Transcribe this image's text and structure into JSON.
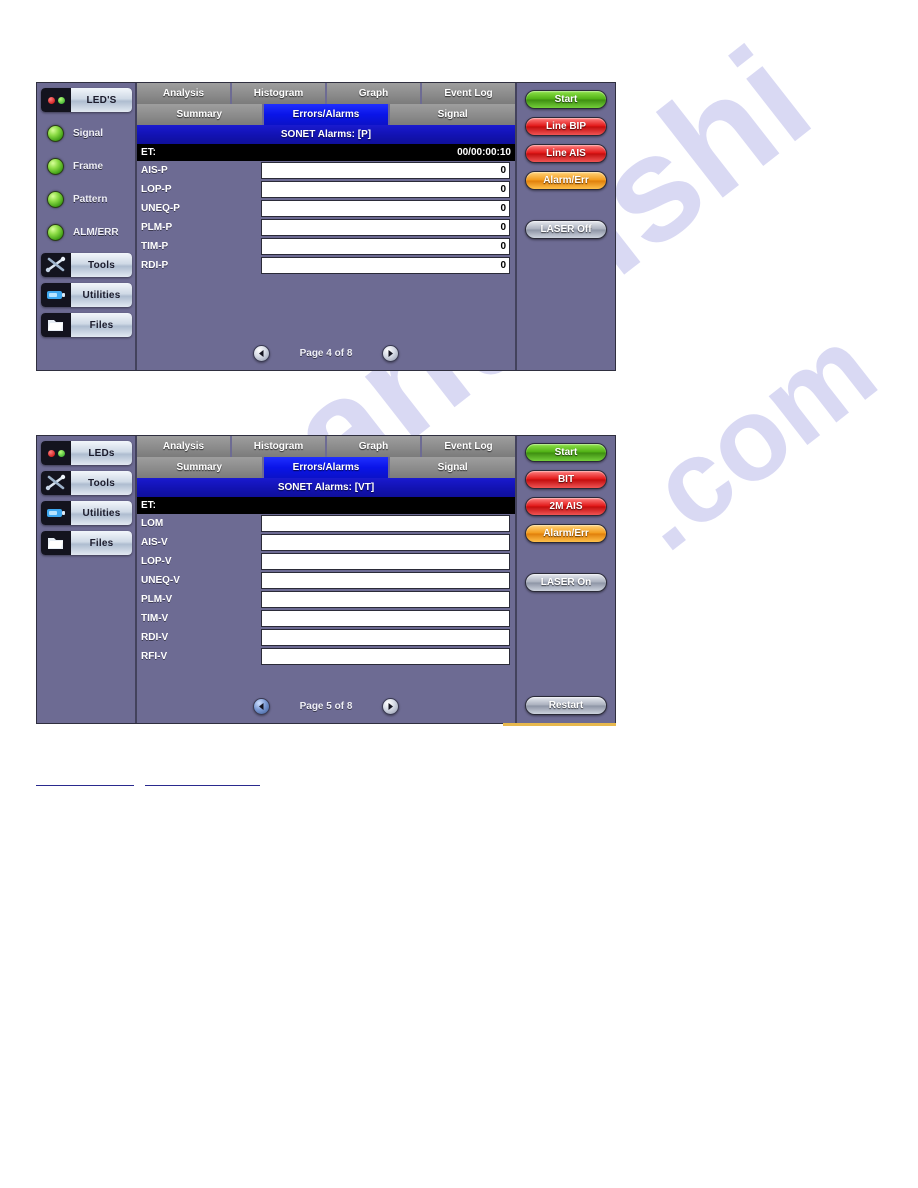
{
  "watermark": {
    "line1": "manualshi",
    "line2": ".com"
  },
  "panels": [
    {
      "id": "panel-1",
      "sidebar": {
        "main_button": {
          "label": "LED'S",
          "icon": "leds-icon"
        },
        "leds": [
          {
            "label": "Signal",
            "color": "#6dc42a"
          },
          {
            "label": "Frame",
            "color": "#6dc42a"
          },
          {
            "label": "Pattern",
            "color": "#6dc42a"
          },
          {
            "label": "ALM/ERR",
            "color": "#6dc42a"
          }
        ],
        "buttons": [
          {
            "label": "Tools",
            "icon": "tools-icon"
          },
          {
            "label": "Utilities",
            "icon": "utilities-icon"
          },
          {
            "label": "Files",
            "icon": "files-icon"
          }
        ]
      },
      "tabs_row1": [
        {
          "label": "Analysis",
          "active": false
        },
        {
          "label": "Histogram",
          "active": false
        },
        {
          "label": "Graph",
          "active": false
        },
        {
          "label": "Event Log",
          "active": false
        }
      ],
      "tabs_row2": [
        {
          "label": "Summary",
          "active": false
        },
        {
          "label": "Errors/Alarms",
          "active": true
        },
        {
          "label": "Signal",
          "active": false
        }
      ],
      "section_title": "SONET Alarms: [P]",
      "et": {
        "label": "ET:",
        "value": "00/00:00:10"
      },
      "rows": [
        {
          "label": "AIS-P",
          "value": "0"
        },
        {
          "label": "LOP-P",
          "value": "0"
        },
        {
          "label": "UNEQ-P",
          "value": "0"
        },
        {
          "label": "PLM-P",
          "value": "0"
        },
        {
          "label": "TIM-P",
          "value": "0"
        },
        {
          "label": "RDI-P",
          "value": "0"
        }
      ],
      "pager": {
        "prev_icon": "arrow-left-icon",
        "label": "Page 4 of 8",
        "next_icon": "arrow-right-icon"
      },
      "actions": [
        {
          "label": "Start",
          "style": "green"
        },
        {
          "label": "Line BIP",
          "style": "red"
        },
        {
          "label": "Line AIS",
          "style": "red"
        },
        {
          "label": "Alarm/Err",
          "style": "orange"
        },
        {
          "label": "LASER Off",
          "style": "gray"
        }
      ]
    },
    {
      "id": "panel-2",
      "sidebar": {
        "main_button": {
          "label": "LEDs",
          "icon": "leds-icon"
        },
        "leds": [],
        "buttons": [
          {
            "label": "Tools",
            "icon": "tools-icon"
          },
          {
            "label": "Utilities",
            "icon": "utilities-icon"
          },
          {
            "label": "Files",
            "icon": "files-icon"
          }
        ]
      },
      "tabs_row1": [
        {
          "label": "Analysis",
          "active": false
        },
        {
          "label": "Histogram",
          "active": false
        },
        {
          "label": "Graph",
          "active": false
        },
        {
          "label": "Event Log",
          "active": false
        }
      ],
      "tabs_row2": [
        {
          "label": "Summary",
          "active": false
        },
        {
          "label": "Errors/Alarms",
          "active": true
        },
        {
          "label": "Signal",
          "active": false
        }
      ],
      "section_title": "SONET Alarms: [VT]",
      "et": {
        "label": "ET:",
        "value": ""
      },
      "rows": [
        {
          "label": "LOM",
          "value": ""
        },
        {
          "label": "AIS-V",
          "value": ""
        },
        {
          "label": "LOP-V",
          "value": ""
        },
        {
          "label": "UNEQ-V",
          "value": ""
        },
        {
          "label": "PLM-V",
          "value": ""
        },
        {
          "label": "TIM-V",
          "value": ""
        },
        {
          "label": "RDI-V",
          "value": ""
        },
        {
          "label": "RFI-V",
          "value": ""
        }
      ],
      "pager": {
        "prev_icon": "arrow-left-icon",
        "label": "Page 5 of 8",
        "next_icon": "arrow-right-icon"
      },
      "actions": [
        {
          "label": "Start",
          "style": "green"
        },
        {
          "label": "BIT",
          "style": "red"
        },
        {
          "label": "2M AIS",
          "style": "red"
        },
        {
          "label": "Alarm/Err",
          "style": "orange"
        },
        {
          "label": "LASER On",
          "style": "gray"
        },
        {
          "label": "Restart",
          "style": "gray"
        }
      ]
    }
  ],
  "colors": {
    "panel_bg": "#6d6b93",
    "tab_inactive": "#8d8d8d",
    "tab_active": "#1313e8",
    "section_title_bg": "#1313b4",
    "et_bar_bg": "#000000",
    "field_bg": "#ffffff",
    "accent_gold": "#e7b84d",
    "rule_blue": "#2a2a8e"
  }
}
